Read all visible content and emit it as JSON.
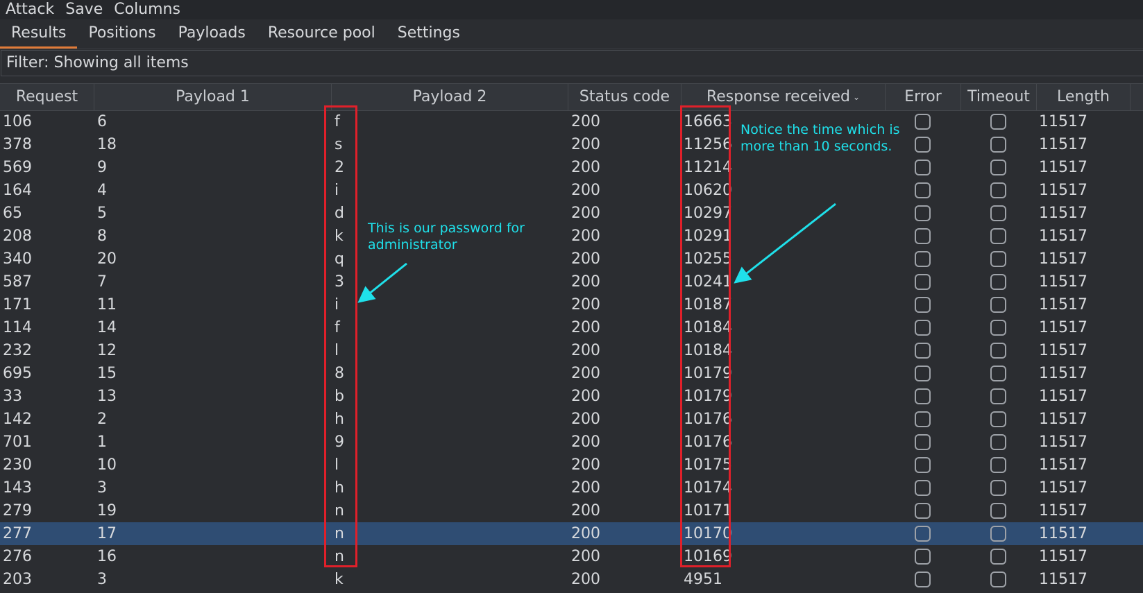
{
  "menu": [
    "Attack",
    "Save",
    "Columns"
  ],
  "tabs": [
    {
      "label": "Results",
      "active": true
    },
    {
      "label": "Positions",
      "active": false
    },
    {
      "label": "Payloads",
      "active": false
    },
    {
      "label": "Resource pool",
      "active": false
    },
    {
      "label": "Settings",
      "active": false
    }
  ],
  "filter": {
    "text": "Filter: Showing all items"
  },
  "columns": [
    "Request",
    "Payload 1",
    "Payload 2",
    "Status code",
    "Response received",
    "Error",
    "Timeout",
    "Length"
  ],
  "sorted_column_icon": "chevron-down-icon",
  "rows": [
    {
      "request": "106",
      "payload1": "6",
      "payload2": "f",
      "status": "200",
      "response": "16663",
      "error": false,
      "timeout": false,
      "length": "11517"
    },
    {
      "request": "378",
      "payload1": "18",
      "payload2": "s",
      "status": "200",
      "response": "11256",
      "error": false,
      "timeout": false,
      "length": "11517"
    },
    {
      "request": "569",
      "payload1": "9",
      "payload2": "2",
      "status": "200",
      "response": "11214",
      "error": false,
      "timeout": false,
      "length": "11517"
    },
    {
      "request": "164",
      "payload1": "4",
      "payload2": "i",
      "status": "200",
      "response": "10620",
      "error": false,
      "timeout": false,
      "length": "11517"
    },
    {
      "request": "65",
      "payload1": "5",
      "payload2": "d",
      "status": "200",
      "response": "10297",
      "error": false,
      "timeout": false,
      "length": "11517"
    },
    {
      "request": "208",
      "payload1": "8",
      "payload2": "k",
      "status": "200",
      "response": "10291",
      "error": false,
      "timeout": false,
      "length": "11517"
    },
    {
      "request": "340",
      "payload1": "20",
      "payload2": "q",
      "status": "200",
      "response": "10255",
      "error": false,
      "timeout": false,
      "length": "11517"
    },
    {
      "request": "587",
      "payload1": "7",
      "payload2": "3",
      "status": "200",
      "response": "10241",
      "error": false,
      "timeout": false,
      "length": "11517"
    },
    {
      "request": "171",
      "payload1": "11",
      "payload2": "i",
      "status": "200",
      "response": "10187",
      "error": false,
      "timeout": false,
      "length": "11517"
    },
    {
      "request": "114",
      "payload1": "14",
      "payload2": "f",
      "status": "200",
      "response": "10184",
      "error": false,
      "timeout": false,
      "length": "11517"
    },
    {
      "request": "232",
      "payload1": "12",
      "payload2": "l",
      "status": "200",
      "response": "10184",
      "error": false,
      "timeout": false,
      "length": "11517"
    },
    {
      "request": "695",
      "payload1": "15",
      "payload2": "8",
      "status": "200",
      "response": "10179",
      "error": false,
      "timeout": false,
      "length": "11517"
    },
    {
      "request": "33",
      "payload1": "13",
      "payload2": "b",
      "status": "200",
      "response": "10179",
      "error": false,
      "timeout": false,
      "length": "11517"
    },
    {
      "request": "142",
      "payload1": "2",
      "payload2": "h",
      "status": "200",
      "response": "10176",
      "error": false,
      "timeout": false,
      "length": "11517"
    },
    {
      "request": "701",
      "payload1": "1",
      "payload2": "9",
      "status": "200",
      "response": "10176",
      "error": false,
      "timeout": false,
      "length": "11517"
    },
    {
      "request": "230",
      "payload1": "10",
      "payload2": "l",
      "status": "200",
      "response": "10175",
      "error": false,
      "timeout": false,
      "length": "11517"
    },
    {
      "request": "143",
      "payload1": "3",
      "payload2": "h",
      "status": "200",
      "response": "10174",
      "error": false,
      "timeout": false,
      "length": "11517"
    },
    {
      "request": "279",
      "payload1": "19",
      "payload2": "n",
      "status": "200",
      "response": "10171",
      "error": false,
      "timeout": false,
      "length": "11517"
    },
    {
      "request": "277",
      "payload1": "17",
      "payload2": "n",
      "status": "200",
      "response": "10170",
      "error": false,
      "timeout": false,
      "length": "11517",
      "selected": true
    },
    {
      "request": "276",
      "payload1": "16",
      "payload2": "n",
      "status": "200",
      "response": "10169",
      "error": false,
      "timeout": false,
      "length": "11517"
    },
    {
      "request": "203",
      "payload1": "3",
      "payload2": "k",
      "status": "200",
      "response": "4951",
      "error": false,
      "timeout": false,
      "length": "11517"
    }
  ],
  "annotations": {
    "password_note": [
      "This is our password for",
      "administrator"
    ],
    "time_note": [
      "Notice the time which is",
      "more than 10 seconds."
    ],
    "box_color": "#e0202a",
    "note_color": "#1fe0ea"
  },
  "colors": {
    "background": "#2b2d31",
    "selected_row": "#2f4d73",
    "active_tab_underline": "#e07b39"
  }
}
